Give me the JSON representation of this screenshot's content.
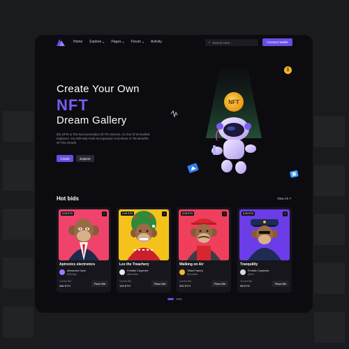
{
  "nav": {
    "links": [
      {
        "label": "Home",
        "dropdown": false
      },
      {
        "label": "Explore",
        "dropdown": true
      },
      {
        "label": "Pages",
        "dropdown": true
      },
      {
        "label": "Forum",
        "dropdown": true
      },
      {
        "label": "Activity",
        "dropdown": false
      }
    ],
    "search_placeholder": "Search Here...",
    "connect_label": "Connect Wallet"
  },
  "hero": {
    "title": "Create Your Own",
    "highlight": "NFT",
    "subtitle": "Dream Gallery",
    "description": "Ikfy NFTs Is The Next Generation Of The Internet. As One Of Its Earliest Explorers, You Will Help Push Its Expansion And Share In The Benefits Of This Growth.",
    "create_label": "Create",
    "explore_label": "Explore",
    "coin_label": "NFT",
    "badge_symbol": "$"
  },
  "hot_bids": {
    "title": "Hot bids",
    "view_all": "View All ↗",
    "cards": [
      {
        "timer": "5:39 ETH",
        "title": "Aptronics electronics",
        "creator": "Alexander Dave",
        "handle": "@Design",
        "bid_label": "Current Bid",
        "bid": "380 ETH",
        "button": "Place Bid",
        "bg": "#f0436c",
        "avatar": "#9b7bff"
      },
      {
        "timer": "2:00 ETH",
        "title": "Les the Treachery",
        "creator": "Freddie Carpenter",
        "handle": "@Icreative",
        "bid_label": "Current Bid",
        "bid": "125 ETH",
        "button": "Place Bid",
        "bg": "#f5c21b",
        "avatar": "#e8e8ee"
      },
      {
        "timer": "5:39 ETH",
        "title": "Walking on Air",
        "creator": "Trista Francis",
        "handle": "@rockstar",
        "bid_label": "Current Bid",
        "bid": "320 ETH",
        "button": "Place Bid",
        "bg": "#ef3f5d",
        "avatar": "#f5b82a"
      },
      {
        "timer": "5:39 ETH",
        "title": "Tranquility",
        "creator": "Freddie Carpenter",
        "handle": "@info",
        "bid_label": "Current Bid",
        "bid": "98 ETH",
        "button": "Place Bid",
        "bg": "#6a3de8",
        "avatar": "#d9d9e2"
      }
    ]
  },
  "pager": {
    "count": 2,
    "active": 0
  },
  "colors": {
    "accent": "#6a4de6",
    "highlight": "#7b5cf5",
    "frame": "#0c0b10",
    "card": "#17161d"
  }
}
